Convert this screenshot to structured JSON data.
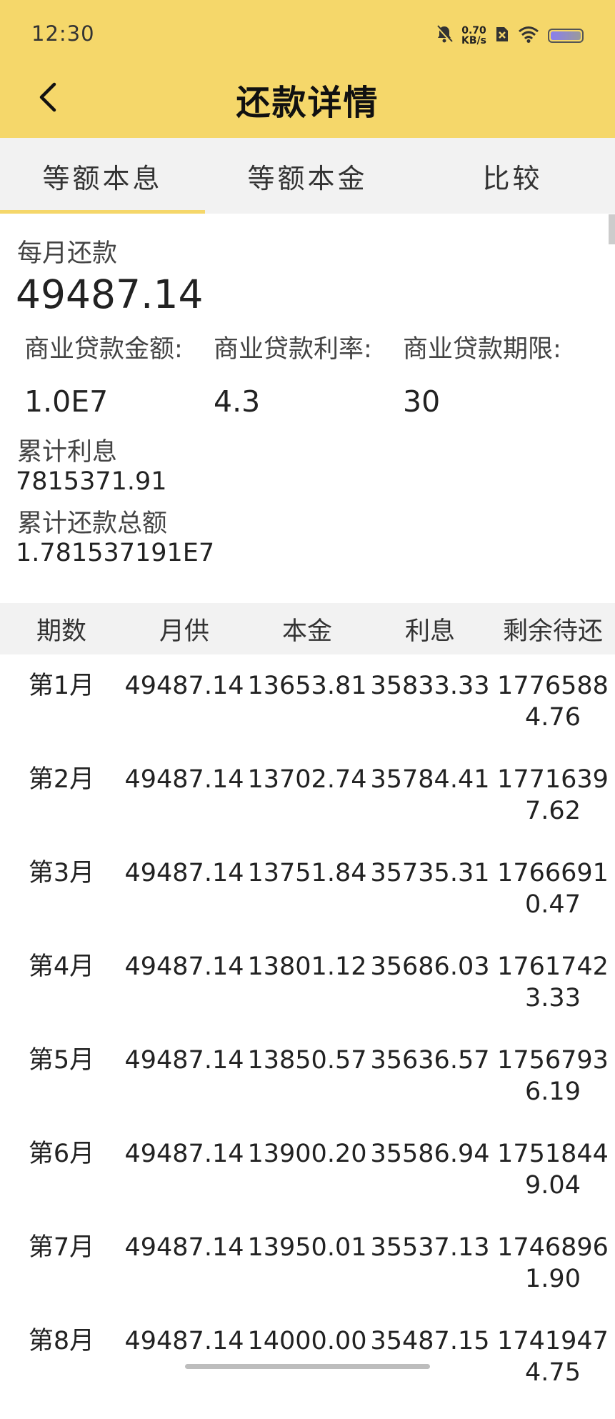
{
  "status_bar": {
    "time": "12:30",
    "net_speed_value": "0.70",
    "net_speed_unit": "KB/s"
  },
  "header": {
    "title": "还款详情"
  },
  "tabs": [
    {
      "label": "等额本息",
      "active": true
    },
    {
      "label": "等额本金",
      "active": false
    },
    {
      "label": "比较",
      "active": false
    }
  ],
  "summary": {
    "monthly_label": "每月还款",
    "monthly_value": "49487.14",
    "amount_label": "商业贷款金额:",
    "amount_value": "1.0E7",
    "rate_label": "商业贷款利率:",
    "rate_value": "4.3",
    "term_label": "商业贷款期限:",
    "term_value": "30",
    "interest_label": "累计利息",
    "interest_value": "7815371.91",
    "total_label": "累计还款总额",
    "total_value": "1.781537191E7"
  },
  "table": {
    "headers": [
      "期数",
      "月供",
      "本金",
      "利息",
      "剩余待还"
    ],
    "rows": [
      [
        "第1月",
        "49487.14",
        "13653.81",
        "35833.33",
        "17765884.76"
      ],
      [
        "第2月",
        "49487.14",
        "13702.74",
        "35784.41",
        "17716397.62"
      ],
      [
        "第3月",
        "49487.14",
        "13751.84",
        "35735.31",
        "17666910.47"
      ],
      [
        "第4月",
        "49487.14",
        "13801.12",
        "35686.03",
        "17617423.33"
      ],
      [
        "第5月",
        "49487.14",
        "13850.57",
        "35636.57",
        "17567936.19"
      ],
      [
        "第6月",
        "49487.14",
        "13900.20",
        "35586.94",
        "17518449.04"
      ],
      [
        "第7月",
        "49487.14",
        "13950.01",
        "35537.13",
        "17468961.90"
      ],
      [
        "第8月",
        "49487.14",
        "14000.00",
        "35487.15",
        "17419474.75"
      ]
    ]
  },
  "colors": {
    "accent": "#f5d76a",
    "tab_background": "#f2f2f2",
    "text_primary": "#222222"
  }
}
